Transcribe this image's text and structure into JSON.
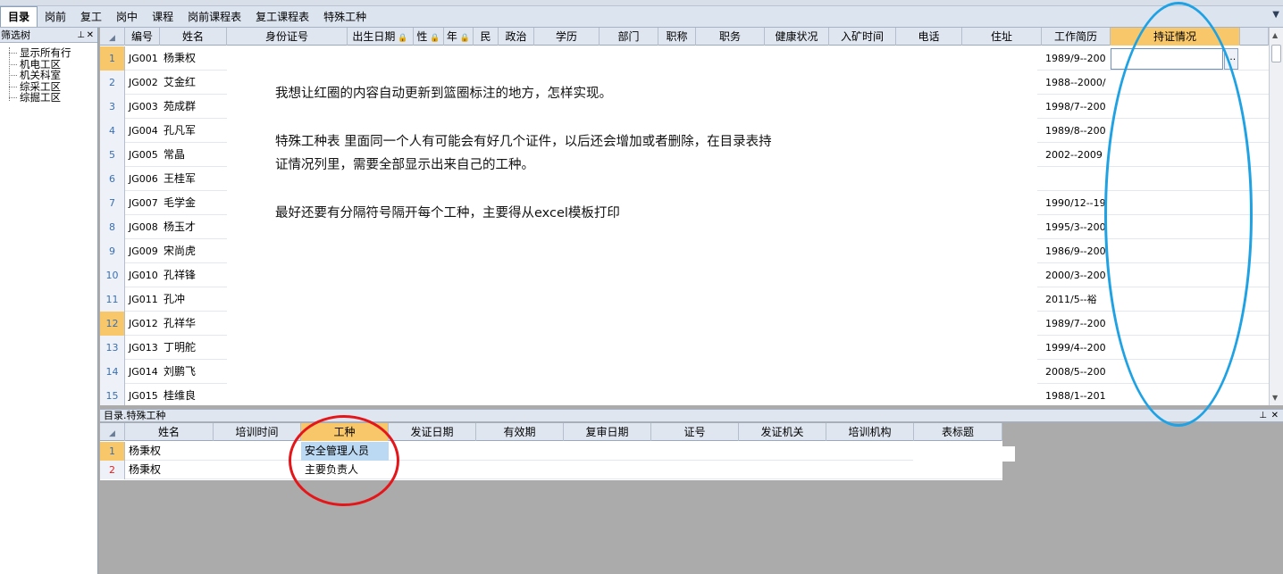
{
  "tabs": [
    "目录",
    "岗前",
    "复工",
    "岗中",
    "课程",
    "岗前课程表",
    "复工课程表",
    "特殊工种"
  ],
  "sidebar": {
    "title": "筛选树",
    "items": [
      "显示所有行",
      "机电工区",
      "机关科室",
      "综采工区",
      "综掘工区"
    ]
  },
  "grid": {
    "columns": [
      "编号",
      "姓名",
      "身份证号",
      "出生日期",
      "性",
      "年",
      "民",
      "政治",
      "学历",
      "部门",
      "职称",
      "职务",
      "健康状况",
      "入矿时间",
      "电话",
      "住址",
      "工作简历",
      "持证情况"
    ],
    "rows": [
      {
        "n": "1",
        "code": "JG001",
        "name": "杨秉权",
        "hist": "1989/9--200"
      },
      {
        "n": "2",
        "code": "JG002",
        "name": "艾金红",
        "hist": "1988--2000/"
      },
      {
        "n": "3",
        "code": "JG003",
        "name": "苑成群",
        "hist": "1998/7--200"
      },
      {
        "n": "4",
        "code": "JG004",
        "name": "孔凡军",
        "hist": "1989/8--200"
      },
      {
        "n": "5",
        "code": "JG005",
        "name": "常晶",
        "hist": "2002--2009"
      },
      {
        "n": "6",
        "code": "JG006",
        "name": "王桂军",
        "hist": ""
      },
      {
        "n": "7",
        "code": "JG007",
        "name": "毛学金",
        "hist": "1990/12--19"
      },
      {
        "n": "8",
        "code": "JG008",
        "name": "杨玉才",
        "hist": "1995/3--200"
      },
      {
        "n": "9",
        "code": "JG009",
        "name": "宋尚虎",
        "hist": "1986/9--200"
      },
      {
        "n": "10",
        "code": "JG010",
        "name": "孔祥锋",
        "hist": "2000/3--200"
      },
      {
        "n": "11",
        "code": "JG011",
        "name": "孔冲",
        "hist": "2011/5--裕"
      },
      {
        "n": "12",
        "code": "JG012",
        "name": "孔祥华",
        "hist": "1989/7--200"
      },
      {
        "n": "13",
        "code": "JG013",
        "name": "丁明舵",
        "hist": "1999/4--200"
      },
      {
        "n": "14",
        "code": "JG014",
        "name": "刘鹏飞",
        "hist": "2008/5--200"
      },
      {
        "n": "15",
        "code": "JG015",
        "name": "桂维良",
        "hist": "1988/1--201"
      }
    ],
    "edit_button": "..."
  },
  "overlay_text": {
    "line1": "我想让红圈的内容自动更新到篮圈标注的地方，怎样实现。",
    "line2": "特殊工种表 里面同一个人有可能会有好几个证件，以后还会增加或者删除，在目录表持",
    "line3": "证情况列里，需要全部显示出来自己的工种。",
    "line4": "最好还要有分隔符号隔开每个工种，主要得从excel模板打印"
  },
  "subpanel": {
    "title": "目录.特殊工种",
    "columns": [
      "姓名",
      "培训时间",
      "工种",
      "发证日期",
      "有效期",
      "复审日期",
      "证号",
      "发证机关",
      "培训机构",
      "表标题"
    ],
    "rows": [
      {
        "n": "1",
        "name": "杨秉权",
        "type": "安全管理人员"
      },
      {
        "n": "2",
        "name": "杨秉权",
        "type": "主要负责人"
      }
    ]
  },
  "colors": {
    "highlight": "#f7c769",
    "red_circle": "#e4161a",
    "blue_circle": "#1ea2e4"
  }
}
